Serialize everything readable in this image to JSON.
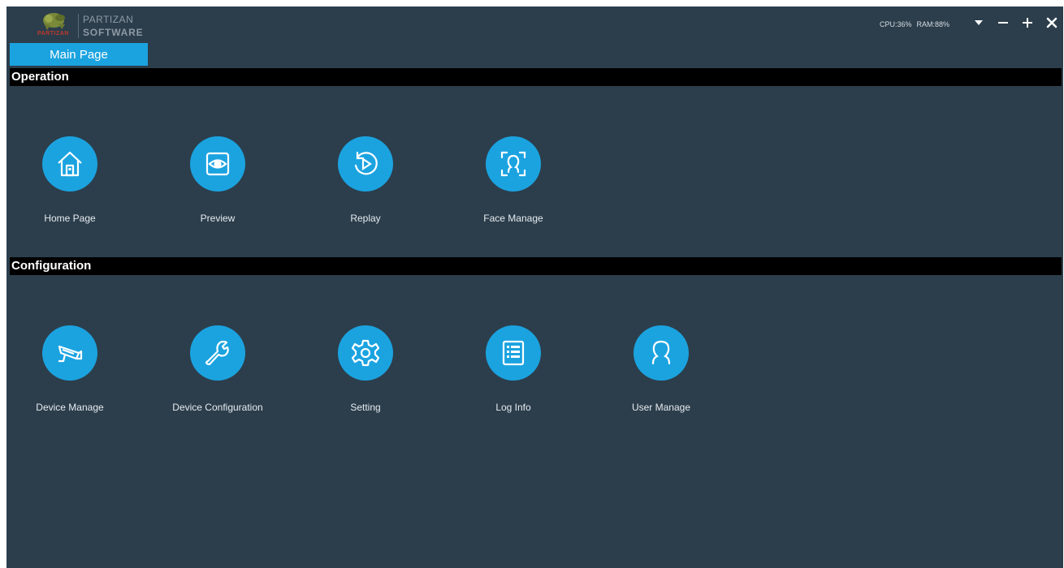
{
  "logo": {
    "line1": "PARTIZAN",
    "line2": "SOFTWARE",
    "mark_text": "PARTIZAN"
  },
  "tabs": {
    "main": "Main Page"
  },
  "status": {
    "cpu": "CPU:36%",
    "ram": "RAM:88%"
  },
  "window_controls": [
    "dropdown-icon",
    "minimize-icon",
    "maximize-icon",
    "close-icon"
  ],
  "sections": {
    "operation": {
      "title": "Operation",
      "items": [
        {
          "label": "Home Page",
          "icon": "home-icon"
        },
        {
          "label": "Preview",
          "icon": "eye-icon"
        },
        {
          "label": "Replay",
          "icon": "replay-icon"
        },
        {
          "label": "Face Manage",
          "icon": "face-icon"
        }
      ]
    },
    "configuration": {
      "title": "Configuration",
      "items": [
        {
          "label": "Device Manage",
          "icon": "camera-icon"
        },
        {
          "label": "Device Configuration",
          "icon": "wrench-icon"
        },
        {
          "label": "Setting",
          "icon": "gear-icon"
        },
        {
          "label": "Log Info",
          "icon": "document-icon"
        },
        {
          "label": "User Manage",
          "icon": "user-icon"
        }
      ]
    }
  },
  "colors": {
    "background": "#2c3e4c",
    "accent": "#1ba3e0",
    "header_bar": "#000000"
  }
}
